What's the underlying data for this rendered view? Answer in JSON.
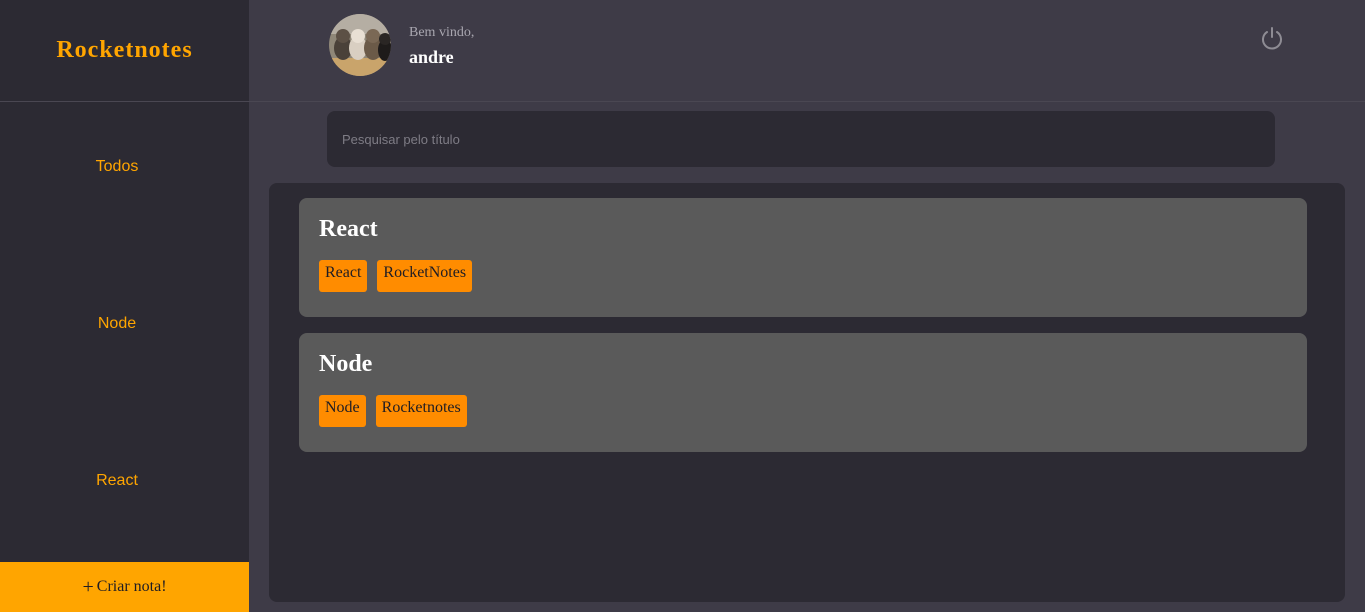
{
  "app": {
    "brand": "Rocketnotes"
  },
  "sidebar": {
    "items": [
      {
        "label": "Todos"
      },
      {
        "label": "Node"
      },
      {
        "label": "React"
      }
    ],
    "create_label": "Criar nota!"
  },
  "header": {
    "greeting": "Bem vindo,",
    "username": "andre",
    "logout_icon": "power-icon"
  },
  "search": {
    "placeholder": "Pesquisar pelo título",
    "value": ""
  },
  "notes": [
    {
      "title": "React",
      "tags": [
        "React",
        "RocketNotes"
      ]
    },
    {
      "title": "Node",
      "tags": [
        "Node",
        "Rocketnotes"
      ]
    }
  ],
  "colors": {
    "accent": "#ffa500",
    "tag": "#ff8c00",
    "sidebar_bg": "#2c2a33",
    "page_bg": "#3e3b47",
    "card_bg": "#5a5a5a"
  }
}
